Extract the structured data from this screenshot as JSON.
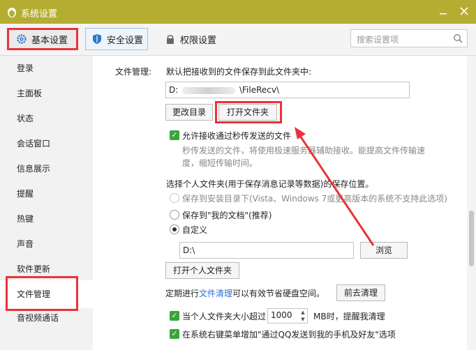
{
  "window": {
    "title": "系统设置"
  },
  "toolbar": {
    "tabs": [
      {
        "label": "基本设置",
        "active": true
      },
      {
        "label": "安全设置"
      },
      {
        "label": "权限设置"
      }
    ],
    "search_placeholder": "搜索设置项"
  },
  "sidebar": {
    "items": [
      {
        "label": "登录"
      },
      {
        "label": "主面板"
      },
      {
        "label": "状态"
      },
      {
        "label": "会话窗口"
      },
      {
        "label": "信息展示"
      },
      {
        "label": "提醒"
      },
      {
        "label": "热键"
      },
      {
        "label": "声音"
      },
      {
        "label": "软件更新"
      },
      {
        "label": "文件管理",
        "active": true
      },
      {
        "label": "音视频通话"
      }
    ]
  },
  "file_mgmt": {
    "section_label": "文件管理:",
    "receive_desc": "默认把接收到的文件保存到此文件夹中:",
    "path_prefix": "D:",
    "path_suffix": "\\FileRecv\\",
    "change_dir_label": "更改目录",
    "open_folder_label": "打开文件夹",
    "allow_flash_label": "允许接收通过秒传发送的文件",
    "flash_note_line1": "秒传发送的文件，将使用极速服务器辅助接收。能提高文件传输速",
    "flash_note_line2": "度，缩短传输时间。",
    "personal_folder_label": "选择个人文件夹(用于保存消息记录等数据)的保存位置。",
    "opt_install_dir": "保存到安装目录下(Vista、Windows 7或更高版本的系统不支持此选项)",
    "opt_my_docs": "保存到\"我的文档\"(推荐)",
    "opt_custom": "自定义",
    "custom_path": "D:\\",
    "browse_label": "浏览",
    "open_personal_label": "打开个人文件夹",
    "cleanup_prefix": "定期进行",
    "cleanup_link": "文件清理",
    "cleanup_suffix": "可以有效节省硬盘空间。",
    "cleanup_button": "前去清理",
    "size_warn_prefix": "当个人文件夹大小超过",
    "size_value": "1000",
    "size_warn_suffix": "MB时，提醒我清理",
    "context_menu_label": "在系统右键菜单增加\"通过QQ发送到我的手机及好友\"选项"
  },
  "colors": {
    "titlebar": "#b5ad31",
    "highlight_red": "#e8333a",
    "check_green": "#39a53b",
    "link_blue": "#2b6fd6"
  }
}
